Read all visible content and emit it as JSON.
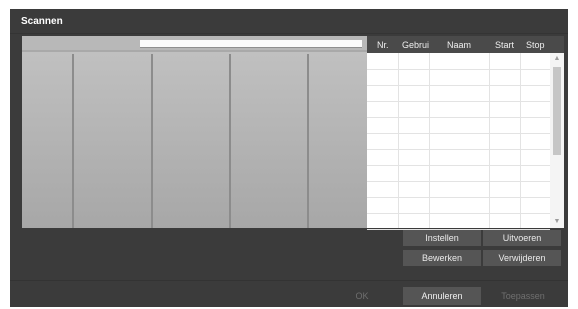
{
  "dialog": {
    "title": "Scannen"
  },
  "table": {
    "headers": [
      "Nr.",
      "Gebrui",
      "Naam",
      "Start",
      "Stop"
    ],
    "rows": [
      [
        "",
        "",
        "",
        "",
        ""
      ],
      [
        "",
        "",
        "",
        "",
        ""
      ],
      [
        "",
        "",
        "",
        "",
        ""
      ],
      [
        "",
        "",
        "",
        "",
        ""
      ],
      [
        "",
        "",
        "",
        "",
        ""
      ],
      [
        "",
        "",
        "",
        "",
        ""
      ],
      [
        "",
        "",
        "",
        "",
        ""
      ],
      [
        "",
        "",
        "",
        "",
        ""
      ],
      [
        "",
        "",
        "",
        "",
        ""
      ],
      [
        "",
        "",
        "",
        "",
        ""
      ],
      [
        "",
        "",
        "",
        "",
        ""
      ]
    ],
    "scroll_up_icon": "chevron-up-icon",
    "scroll_down_icon": "chevron-down-icon"
  },
  "actions": {
    "setup": "Instellen",
    "execute": "Uitvoeren",
    "edit": "Bewerken",
    "remove": "Verwijderen"
  },
  "footer": {
    "ok": "OK",
    "cancel": "Annuleren",
    "apply": "Toepassen"
  },
  "colors": {
    "dialog_bg": "#3b3b3b",
    "button_bg": "#555555",
    "disabled_text": "#6f6f6f"
  }
}
